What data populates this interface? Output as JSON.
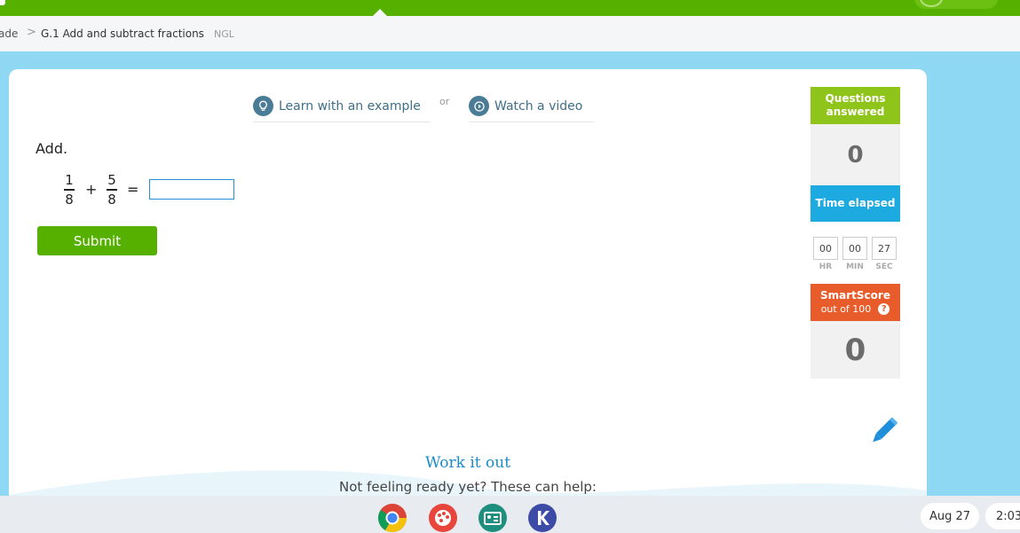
{
  "breadcrumb": {
    "previous": "ade",
    "separator": ">",
    "current": "G.1 Add and subtract fractions",
    "code": "NGL"
  },
  "help": {
    "example_label": "Learn with an example",
    "or_label": "or",
    "video_label": "Watch a video"
  },
  "question": {
    "prompt": "Add.",
    "fraction1": {
      "numerator": "1",
      "denominator": "8"
    },
    "operator": "+",
    "fraction2": {
      "numerator": "5",
      "denominator": "8"
    },
    "equals": "=",
    "answer_value": ""
  },
  "submit_label": "Submit",
  "stats": {
    "questions_answered_label": "Questions answered",
    "questions_answered_value": "0",
    "time_elapsed_label": "Time elapsed",
    "time": {
      "hr": "00",
      "min": "00",
      "sec": "27"
    },
    "time_units": {
      "hr": "HR",
      "min": "MIN",
      "sec": "SEC"
    },
    "smartscore_label": "SmartScore",
    "smartscore_sub": "out of 100",
    "smartscore_help": "?",
    "smartscore_value": "0"
  },
  "work_it_out": {
    "title": "Work it out",
    "subtitle": "Not feeling ready yet? These can help:"
  },
  "taskbar": {
    "apps": [
      "chrome-icon",
      "palette-icon",
      "classroom-icon",
      "kami-icon"
    ],
    "date": "Aug 27",
    "time": "2:03"
  },
  "colors": {
    "brand_green": "#56b000",
    "questions_green": "#8fc41a",
    "time_blue": "#1daae0",
    "smartscore_orange": "#e85c2c",
    "page_background": "#8fd8f3"
  }
}
